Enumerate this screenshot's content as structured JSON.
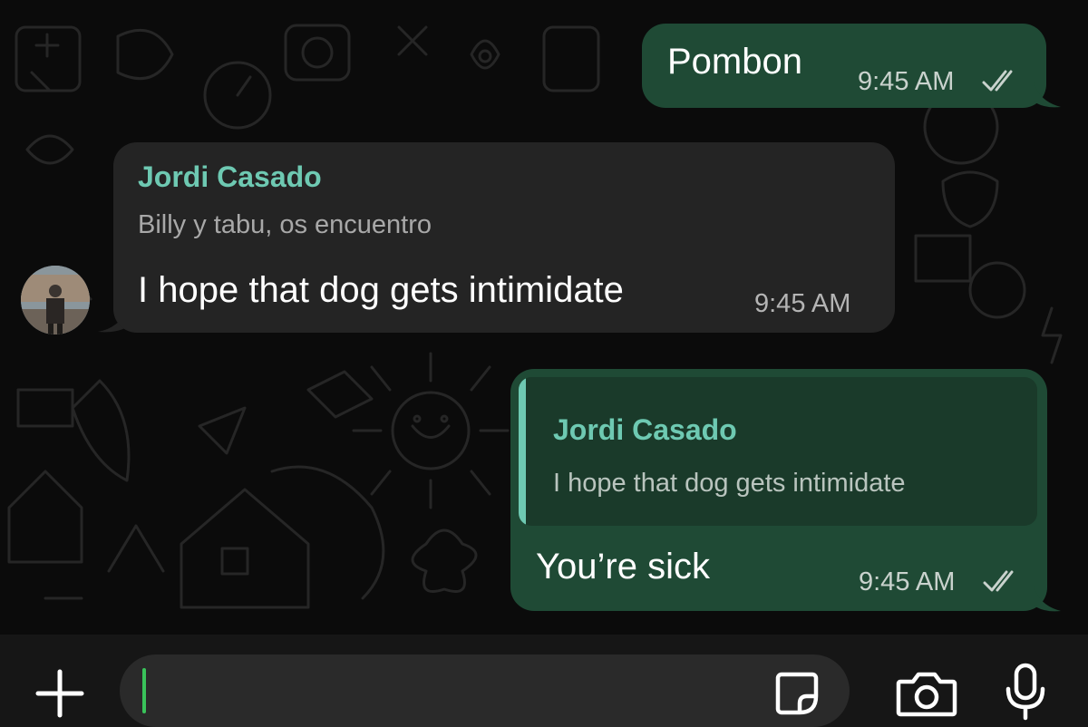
{
  "chat": {
    "messages": [
      {
        "direction": "outgoing",
        "text": "Pombon",
        "time": "9:45 AM",
        "status_icon": "double-check-icon"
      },
      {
        "direction": "incoming",
        "sender": "Jordi Casado",
        "forwarded_text": "Billy y tabu, os encuentro",
        "text": "I hope that dog gets intimidate",
        "time": "9:45 AM",
        "avatar_icon": "user-avatar"
      },
      {
        "direction": "outgoing",
        "quote": {
          "sender": "Jordi Casado",
          "text": "I hope that dog gets intimidate"
        },
        "text": "You’re sick",
        "time": "9:45 AM",
        "status_icon": "double-check-icon"
      }
    ]
  },
  "composer": {
    "value": "",
    "icons": [
      "plus-icon",
      "sticker-icon",
      "camera-icon",
      "microphone-icon"
    ]
  },
  "colors": {
    "background": "#0b0b0b",
    "outgoing_bubble": "#1f4a35",
    "incoming_bubble": "#242424",
    "sender_name": "#6ec9b2",
    "caret": "#39c35a"
  }
}
